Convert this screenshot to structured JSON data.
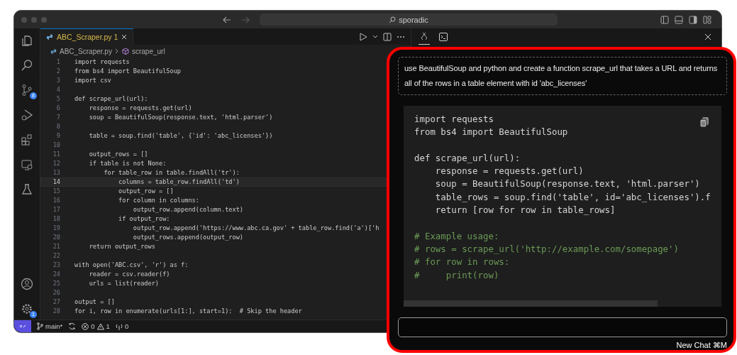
{
  "window": {
    "search": "sporadic"
  },
  "activity_bar": [
    {
      "kind": "explorer"
    },
    {
      "kind": "search"
    },
    {
      "kind": "source-control",
      "badge": "8"
    },
    {
      "kind": "run"
    },
    {
      "kind": "extensions"
    },
    {
      "kind": "remote"
    },
    {
      "kind": "testing"
    }
  ],
  "activity_bottom": [
    {
      "kind": "account"
    },
    {
      "kind": "settings",
      "badge": "1"
    }
  ],
  "editor": {
    "tabs": [
      {
        "label": "ABC_Scraper.py 1",
        "selected": true
      }
    ],
    "breadcrumb": [
      "ABC_Scraper.py",
      "scrape_url"
    ],
    "lines": [
      {
        "number": "1",
        "text": "import requests",
        "selected": false
      },
      {
        "number": "2",
        "text": "from bs4 import BeautifulSoup",
        "selected": false
      },
      {
        "number": "3",
        "text": "import csv",
        "selected": false
      },
      {
        "number": "4",
        "selected": false
      },
      {
        "number": "5",
        "text": "def scrape_url(url):",
        "selected": false
      },
      {
        "number": "6",
        "text": "    response = requests.get(url)",
        "selected": false
      },
      {
        "number": "7",
        "text": "    soup = BeautifulSoup(response.text, 'html.parser')",
        "selected": false
      },
      {
        "number": "8",
        "selected": false
      },
      {
        "number": "9",
        "text": "    table = soup.find('table', {'id': 'abc_licenses'})",
        "selected": false
      },
      {
        "number": "10",
        "selected": false
      },
      {
        "number": "11",
        "text": "    output_rows = []",
        "selected": false
      },
      {
        "number": "12",
        "text": "    if table is not None:",
        "selected": false
      },
      {
        "number": "13",
        "text": "        for table_row in table.findAll('tr'):",
        "selected": false
      },
      {
        "number": "14",
        "text": "            columns = table_row.findAll('td')",
        "selected": true
      },
      {
        "number": "15",
        "text": "            output_row = []",
        "selected": false
      },
      {
        "number": "16",
        "text": "            for column in columns:",
        "selected": false
      },
      {
        "number": "17",
        "text": "                output_row.append(column.text)",
        "selected": false
      },
      {
        "number": "18",
        "text": "            if output_row:",
        "selected": false
      },
      {
        "number": "19",
        "text": "                output_row.append('https://www.abc.ca.gov' + table_row.find('a')['h",
        "selected": false
      },
      {
        "number": "20",
        "text": "                output_rows.append(output_row)",
        "selected": false
      },
      {
        "number": "21",
        "text": "    return output_rows",
        "selected": false
      },
      {
        "number": "22",
        "selected": false
      },
      {
        "number": "23",
        "text": "with open('ABC.csv', 'r') as f:",
        "selected": false
      },
      {
        "number": "24",
        "text": "    reader = csv.reader(f)",
        "selected": false
      },
      {
        "number": "25",
        "text": "    urls = list(reader)",
        "selected": false
      },
      {
        "number": "26",
        "selected": false
      },
      {
        "number": "27",
        "text": "output = []",
        "selected": false
      },
      {
        "number": "28",
        "text": "for i, row in enumerate(urls[1:], start=1):  # Skip the header",
        "selected": false
      }
    ]
  },
  "panel_tabs": [
    {
      "kind": "chat",
      "selected": true
    },
    {
      "kind": "terminal",
      "selected": false
    }
  ],
  "status_bar": {
    "branch": "main*",
    "errors": "0",
    "warnings": "1",
    "ports": "0"
  },
  "chat": {
    "prompt": "use BeautifulSoup and python and create a function scrape_url that takes a URL and returns all of the rows in a table element with id 'abc_licenses'",
    "code": [
      {
        "kind": "code",
        "text": "import requests"
      },
      {
        "kind": "code",
        "text": "from bs4 import BeautifulSoup"
      },
      {
        "kind": "blank"
      },
      {
        "kind": "code",
        "text": "def scrape_url(url):"
      },
      {
        "kind": "code",
        "text": "    response = requests.get(url)"
      },
      {
        "kind": "code",
        "text": "    soup = BeautifulSoup(response.text, 'html.parser')"
      },
      {
        "kind": "code",
        "text": "    table_rows = soup.find('table', id='abc_licenses').f"
      },
      {
        "kind": "code",
        "text": "    return [row for row in table_rows]"
      },
      {
        "kind": "blank"
      },
      {
        "kind": "comment",
        "text": "# Example usage:"
      },
      {
        "kind": "comment",
        "text": "# rows = scrape_url('http://example.com/somepage')"
      },
      {
        "kind": "comment",
        "text": "# for row in rows:"
      },
      {
        "kind": "comment",
        "text": "#     print(row)"
      }
    ],
    "new_chat": "New Chat ⌘M"
  }
}
